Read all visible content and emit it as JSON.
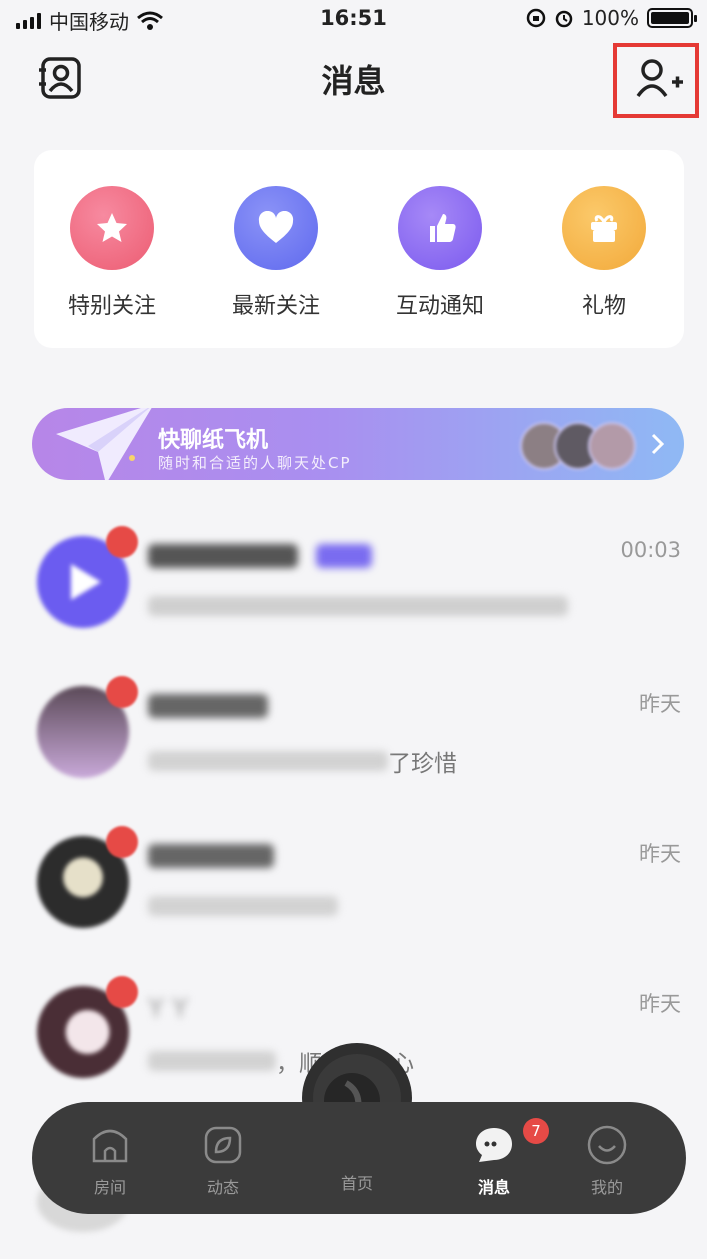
{
  "status_bar": {
    "carrier": "中国移动",
    "time": "16:51",
    "battery": "100%"
  },
  "header": {
    "title": "消息"
  },
  "quick_actions": [
    {
      "label": "特别关注",
      "color": "#f06a80",
      "icon": "star-icon"
    },
    {
      "label": "最新关注",
      "color": "#6f79f3",
      "icon": "heart-icon"
    },
    {
      "label": "互动通知",
      "color": "#8a6cf0",
      "icon": "thumb-icon"
    },
    {
      "label": "礼物",
      "color": "#f7b84c",
      "icon": "gift-icon"
    }
  ],
  "banner": {
    "title": "快聊纸飞机",
    "subtitle": "随时和合适的人聊天处CP"
  },
  "messages": [
    {
      "name": "",
      "preview": "",
      "time": "00:03"
    },
    {
      "name": "",
      "preview": "了珍惜",
      "time": "昨天"
    },
    {
      "name": "",
      "preview": "",
      "time": "昨天"
    },
    {
      "name": "Y Y",
      "preview": "，顺自己的心",
      "time": "昨天"
    }
  ],
  "bottom_nav": [
    {
      "label": "房间",
      "icon": "house-icon"
    },
    {
      "label": "动态",
      "icon": "leaf-icon"
    },
    {
      "label": "首页",
      "icon": "disc-icon"
    },
    {
      "label": "消息",
      "icon": "chat-icon",
      "badge": "7",
      "active": true
    },
    {
      "label": "我的",
      "icon": "smile-icon"
    }
  ],
  "colors": {
    "accent_red": "#e53935",
    "badge_red": "#e64a46",
    "nav_bg": "#3b3b3b"
  }
}
